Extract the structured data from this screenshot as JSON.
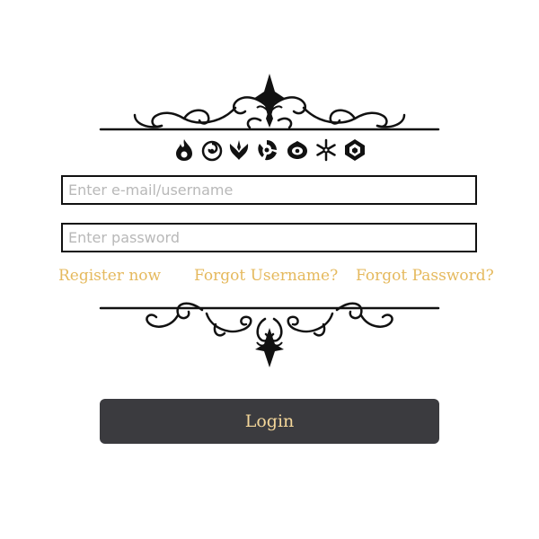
{
  "form": {
    "email_placeholder": "Enter e-mail/username",
    "password_placeholder": "Enter password",
    "email_value": "",
    "password_value": ""
  },
  "links": {
    "register": "Register now",
    "forgot_username": "Forgot Username?",
    "forgot_password": "Forgot Password?"
  },
  "login_button": {
    "label": "Login"
  },
  "decor": {
    "ornament_top": "flourish-divider",
    "ornament_bottom": "flourish-divider-inverted",
    "element_icons": [
      "pyro-icon",
      "hydro-icon",
      "anemo-icon",
      "electro-icon",
      "dendro-icon",
      "cryo-icon",
      "geo-icon"
    ]
  },
  "colors": {
    "link": "#e5b95d",
    "button_bg": "#3b3b3f",
    "button_text": "#f4d79a",
    "field_border": "#111111",
    "placeholder": "#b8b8b8",
    "ornament": "#111111"
  }
}
